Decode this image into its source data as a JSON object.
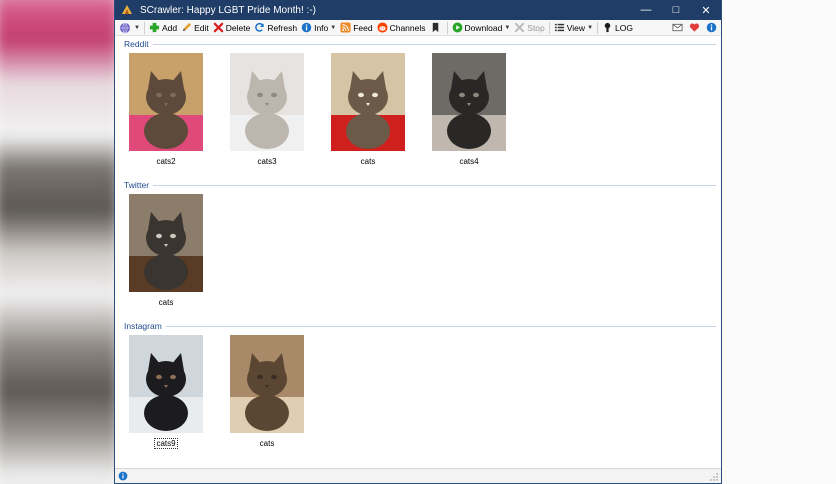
{
  "window": {
    "title": "SCrawler: Happy LGBT Pride Month! :-)",
    "minimize_glyph": "—",
    "maximize_glyph": "□",
    "close_glyph": "✕"
  },
  "toolbar": {
    "menu_icon": "globe-menu-icon",
    "add": "Add",
    "edit": "Edit",
    "delete": "Delete",
    "refresh": "Refresh",
    "info": "Info",
    "feed": "Feed",
    "channels": "Channels",
    "download": "Download",
    "stop": "Stop",
    "view": "View",
    "log": "LOG"
  },
  "colors": {
    "titlebar": "#1f3d66",
    "group_header": "#1f4b8f",
    "add_green": "#2aa52a",
    "delete_red": "#d61f1f",
    "feed_orange": "#f08a24",
    "info_blue": "#1a73c9"
  },
  "groups": [
    {
      "name": "Reddit",
      "items": [
        {
          "caption": "cats2",
          "palette": [
            "#c7a06a",
            "#5e4a3a",
            "#e04a7a",
            "#7d6b5c"
          ]
        },
        {
          "caption": "cats3",
          "palette": [
            "#e6e3e0",
            "#bdb6ae",
            "#f0f0f0",
            "#8e8982"
          ]
        },
        {
          "caption": "cats",
          "palette": [
            "#d6c4a6",
            "#6b5a47",
            "#d0201e",
            "#f0e8da"
          ]
        },
        {
          "caption": "cats4",
          "palette": [
            "#6e6a66",
            "#2a2826",
            "#c0b8ae",
            "#8d8780"
          ]
        }
      ]
    },
    {
      "name": "Twitter",
      "items": [
        {
          "caption": "cats",
          "palette": [
            "#8c7c6a",
            "#3a3530",
            "#5a3b26",
            "#cfc7bd"
          ]
        }
      ]
    },
    {
      "name": "Instagram",
      "items": [
        {
          "caption": "cats9",
          "palette": [
            "#cfd6dc",
            "#1c1c1e",
            "#e9ecef",
            "#8a6d55"
          ],
          "focused": true
        },
        {
          "caption": "cats",
          "palette": [
            "#a88a68",
            "#5b4633",
            "#e0cdb2",
            "#3a2e24"
          ]
        }
      ]
    }
  ]
}
